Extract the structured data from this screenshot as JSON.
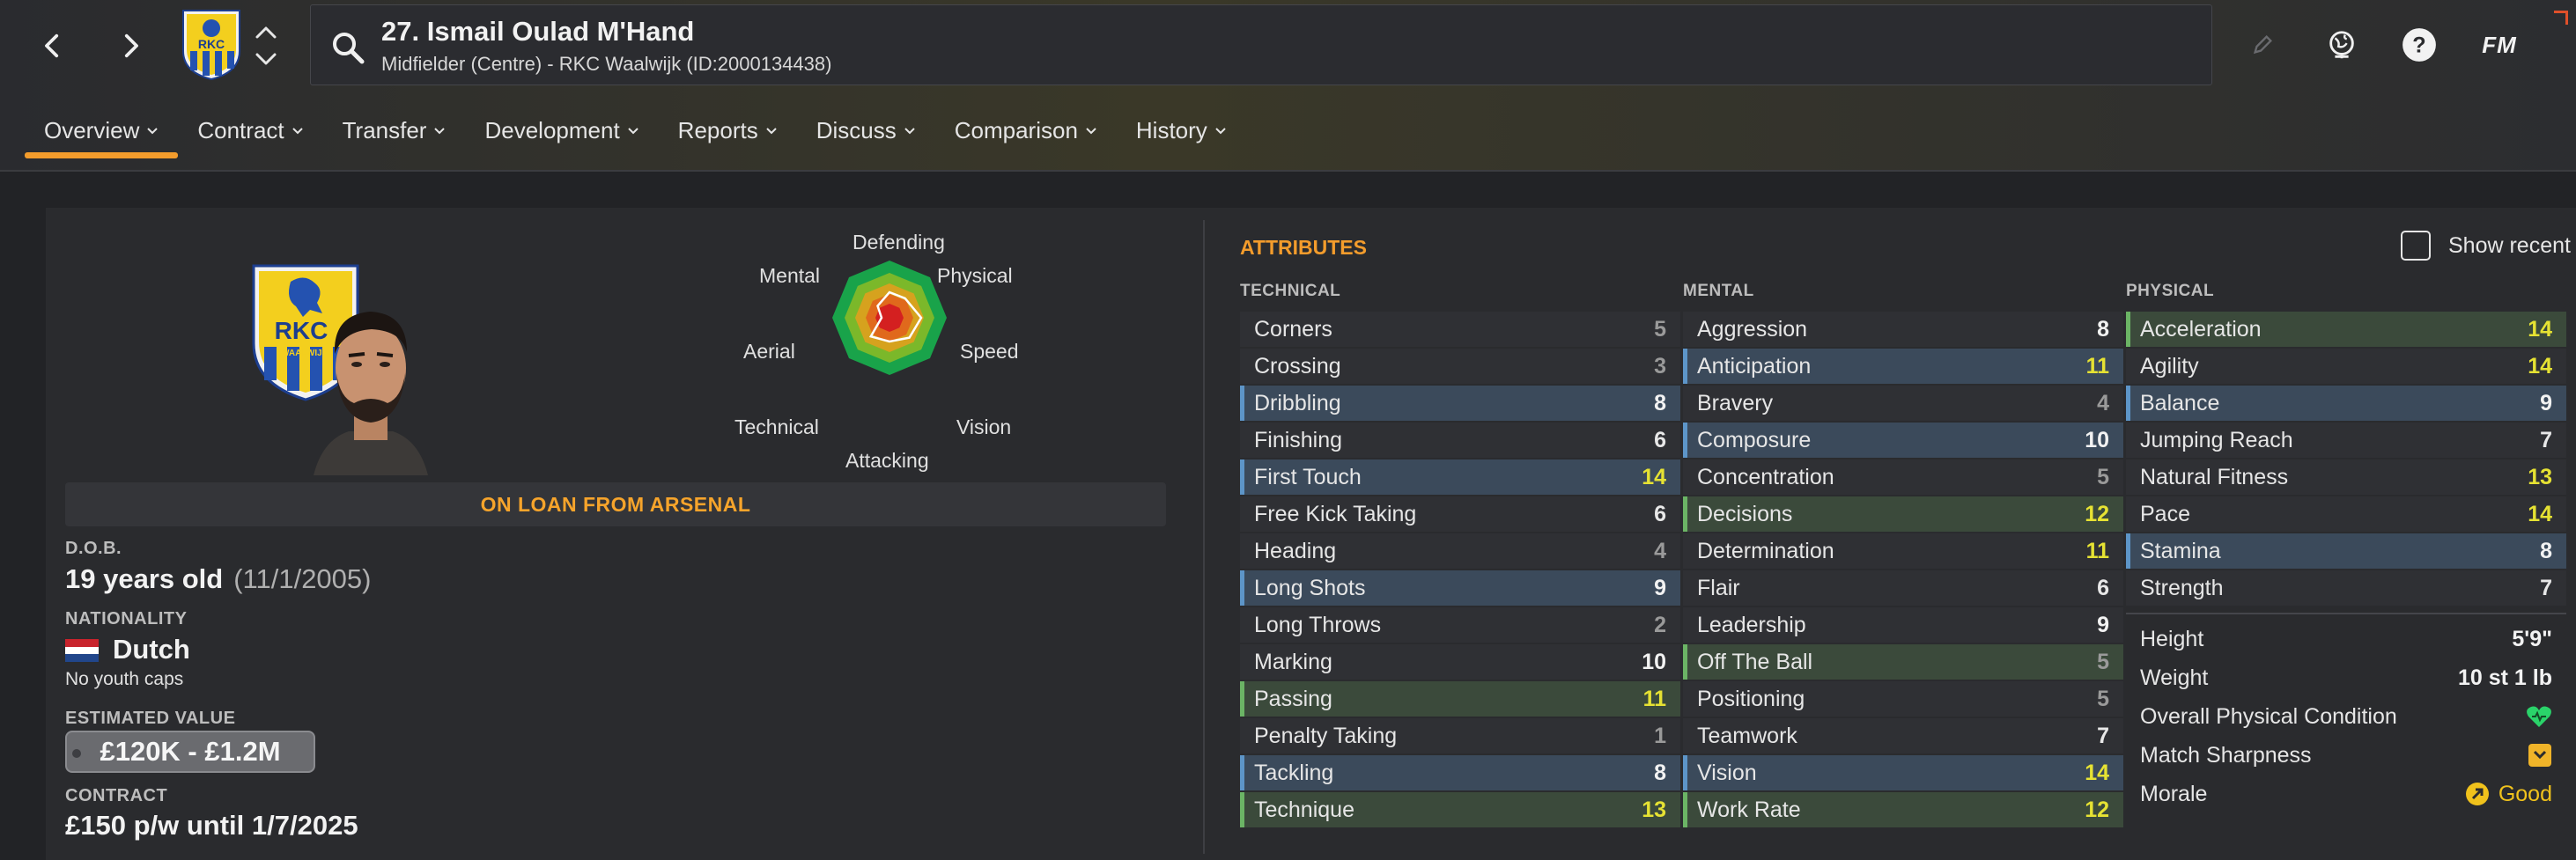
{
  "header": {
    "title": "27. Ismail Oulad M'Hand",
    "subtitle": "Midfielder (Centre) - RKC Waalwijk (ID:2000134438)",
    "crest_text": "RKC",
    "fm_label": "FM",
    "help_label": "?"
  },
  "tabs": [
    {
      "label": "Overview",
      "active": true
    },
    {
      "label": "Contract"
    },
    {
      "label": "Transfer"
    },
    {
      "label": "Development"
    },
    {
      "label": "Reports"
    },
    {
      "label": "Discuss"
    },
    {
      "label": "Comparison"
    },
    {
      "label": "History"
    }
  ],
  "radar": {
    "labels": {
      "defending": "Defending",
      "physical": "Physical",
      "speed": "Speed",
      "vision": "Vision",
      "attacking": "Attacking",
      "technical": "Technical",
      "aerial": "Aerial",
      "mental": "Mental"
    }
  },
  "profile": {
    "crest_text": "RKC",
    "crest_sub": "WAALWIJK",
    "loan_banner": "ON LOAN FROM ARSENAL",
    "dob_label": "D.O.B.",
    "dob_value": "19 years old",
    "dob_date": "(11/1/2005)",
    "nationality_label": "NATIONALITY",
    "nationality_value": "Dutch",
    "youth_caps": "No youth caps",
    "value_label": "ESTIMATED VALUE",
    "value": "£120K - £1.2M",
    "contract_label": "CONTRACT",
    "contract_value": "£150 p/w until 1/7/2025"
  },
  "attributes": {
    "title": "ATTRIBUTES",
    "show_recent": "Show recent",
    "technical_label": "TECHNICAL",
    "mental_label": "MENTAL",
    "physical_label": "PHYSICAL",
    "technical": [
      {
        "name": "Corners",
        "value": "5",
        "hl": "",
        "tone": "c-low"
      },
      {
        "name": "Crossing",
        "value": "3",
        "hl": "",
        "tone": "c-low"
      },
      {
        "name": "Dribbling",
        "value": "8",
        "hl": "blue",
        "tone": "c-high"
      },
      {
        "name": "Finishing",
        "value": "6",
        "hl": "",
        "tone": "c-mid"
      },
      {
        "name": "First Touch",
        "value": "14",
        "hl": "blue",
        "tone": "c-yel"
      },
      {
        "name": "Free Kick Taking",
        "value": "6",
        "hl": "",
        "tone": "c-mid"
      },
      {
        "name": "Heading",
        "value": "4",
        "hl": "",
        "tone": "c-low"
      },
      {
        "name": "Long Shots",
        "value": "9",
        "hl": "blue",
        "tone": "c-high"
      },
      {
        "name": "Long Throws",
        "value": "2",
        "hl": "",
        "tone": "c-low"
      },
      {
        "name": "Marking",
        "value": "10",
        "hl": "",
        "tone": "c-high"
      },
      {
        "name": "Passing",
        "value": "11",
        "hl": "green",
        "tone": "c-yel"
      },
      {
        "name": "Penalty Taking",
        "value": "1",
        "hl": "",
        "tone": "c-low"
      },
      {
        "name": "Tackling",
        "value": "8",
        "hl": "blue",
        "tone": "c-high"
      },
      {
        "name": "Technique",
        "value": "13",
        "hl": "green",
        "tone": "c-yel"
      }
    ],
    "mental": [
      {
        "name": "Aggression",
        "value": "8",
        "hl": "",
        "tone": "c-high"
      },
      {
        "name": "Anticipation",
        "value": "11",
        "hl": "blue",
        "tone": "c-yel"
      },
      {
        "name": "Bravery",
        "value": "4",
        "hl": "",
        "tone": "c-low"
      },
      {
        "name": "Composure",
        "value": "10",
        "hl": "blue",
        "tone": "c-high"
      },
      {
        "name": "Concentration",
        "value": "5",
        "hl": "",
        "tone": "c-low"
      },
      {
        "name": "Decisions",
        "value": "12",
        "hl": "green",
        "tone": "c-yel"
      },
      {
        "name": "Determination",
        "value": "11",
        "hl": "",
        "tone": "c-yel"
      },
      {
        "name": "Flair",
        "value": "6",
        "hl": "",
        "tone": "c-mid"
      },
      {
        "name": "Leadership",
        "value": "9",
        "hl": "",
        "tone": "c-high"
      },
      {
        "name": "Off The Ball",
        "value": "5",
        "hl": "green",
        "tone": "c-low"
      },
      {
        "name": "Positioning",
        "value": "5",
        "hl": "",
        "tone": "c-low"
      },
      {
        "name": "Teamwork",
        "value": "7",
        "hl": "",
        "tone": "c-mid"
      },
      {
        "name": "Vision",
        "value": "14",
        "hl": "blue",
        "tone": "c-yel"
      },
      {
        "name": "Work Rate",
        "value": "12",
        "hl": "green",
        "tone": "c-yel"
      }
    ],
    "physical": [
      {
        "name": "Acceleration",
        "value": "14",
        "hl": "green",
        "tone": "c-yel"
      },
      {
        "name": "Agility",
        "value": "14",
        "hl": "",
        "tone": "c-yel"
      },
      {
        "name": "Balance",
        "value": "9",
        "hl": "blue",
        "tone": "c-high"
      },
      {
        "name": "Jumping Reach",
        "value": "7",
        "hl": "",
        "tone": "c-mid"
      },
      {
        "name": "Natural Fitness",
        "value": "13",
        "hl": "",
        "tone": "c-yel"
      },
      {
        "name": "Pace",
        "value": "14",
        "hl": "",
        "tone": "c-yel"
      },
      {
        "name": "Stamina",
        "value": "8",
        "hl": "blue",
        "tone": "c-high"
      },
      {
        "name": "Strength",
        "value": "7",
        "hl": "",
        "tone": "c-mid"
      }
    ],
    "physical_info": {
      "height_label": "Height",
      "height_value": "5'9\"",
      "weight_label": "Weight",
      "weight_value": "10 st 1 lb",
      "condition_label": "Overall Physical Condition",
      "condition_icon": "heart-icon",
      "sharpness_label": "Match Sharpness",
      "sharpness_icon": "chevron-badge-icon",
      "morale_label": "Morale",
      "morale_value": "Good",
      "morale_icon": "morale-arrow-icon"
    }
  },
  "colors": {
    "accent": "#f39c2c",
    "highlight_value": "#e6e233",
    "blue_highlight": "#3b4a5b",
    "green_highlight": "#3b4a3b"
  }
}
